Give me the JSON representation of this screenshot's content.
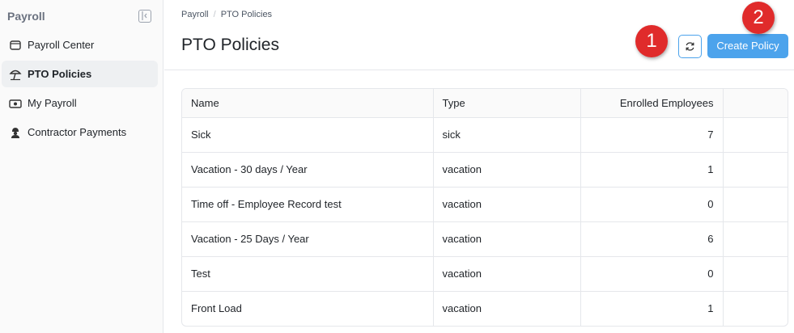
{
  "sidebar": {
    "title": "Payroll",
    "items": [
      {
        "label": "Payroll Center",
        "icon": "wallet-icon"
      },
      {
        "label": "PTO Policies",
        "icon": "beach-umbrella-icon",
        "active": true
      },
      {
        "label": "My Payroll",
        "icon": "money-icon"
      },
      {
        "label": "Contractor Payments",
        "icon": "contractor-icon"
      }
    ]
  },
  "breadcrumb": {
    "root": "Payroll",
    "current": "PTO Policies"
  },
  "header": {
    "title": "PTO Policies",
    "create_label": "Create Policy",
    "refresh_icon": "refresh-icon"
  },
  "callouts": {
    "one": "1",
    "two": "2"
  },
  "colors": {
    "accent": "#4ca3ec",
    "callout": "#e02b2b"
  },
  "table": {
    "columns": {
      "name": "Name",
      "type": "Type",
      "enrolled": "Enrolled Employees"
    },
    "rows": [
      {
        "name": "Sick",
        "type": "sick",
        "enrolled": "7"
      },
      {
        "name": "Vacation - 30 days / Year",
        "type": "vacation",
        "enrolled": "1"
      },
      {
        "name": "Time off - Employee Record test",
        "type": "vacation",
        "enrolled": "0"
      },
      {
        "name": "Vacation - 25 Days / Year",
        "type": "vacation",
        "enrolled": "6"
      },
      {
        "name": "Test",
        "type": "vacation",
        "enrolled": "0"
      },
      {
        "name": "Front Load",
        "type": "vacation",
        "enrolled": "1"
      }
    ]
  }
}
